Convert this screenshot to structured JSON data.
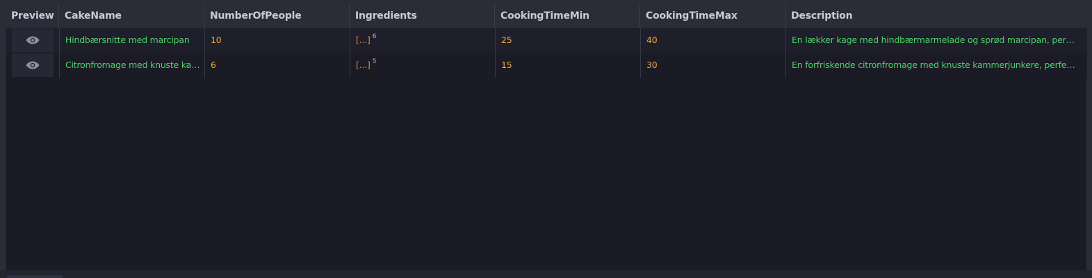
{
  "table": {
    "columns": [
      "Preview",
      "CakeName",
      "NumberOfPeople",
      "Ingredients",
      "CookingTimeMin",
      "CookingTimeMax",
      "Description"
    ],
    "rows": [
      {
        "preview_icon": "eye-icon",
        "cake_name": "Hindbærsnitte med marcipan",
        "number_of_people": "10",
        "ingredients": "[...]",
        "ingredients_count": "6",
        "cooking_time_min": "25",
        "cooking_time_max": "40",
        "description": "En lækker kage med hindbærmarmelade og sprød marcipan, perfekt t..."
      },
      {
        "preview_icon": "eye-icon",
        "cake_name": "Citronfromage med knuste kam...",
        "number_of_people": "6",
        "ingredients": "[...]",
        "ingredients_count": "5",
        "cooking_time_min": "15",
        "cooking_time_max": "30",
        "description": "En forfriskende citronfromage med knuste kammerjunkere, perfekt til..."
      }
    ]
  },
  "colors": {
    "background": "#1b1b26",
    "header_background": "#2a2d38",
    "string_value": "#4fd06a",
    "number_value": "#f0a93c",
    "array_value": "#e0893a"
  }
}
